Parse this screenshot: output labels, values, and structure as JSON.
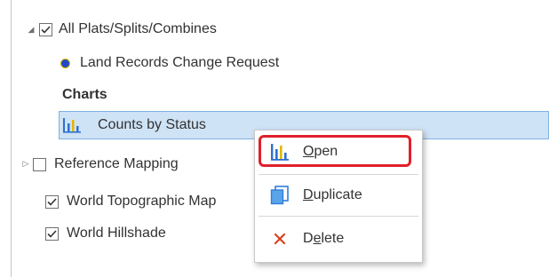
{
  "tree": {
    "layer_group": {
      "label": "All Plats/Splits/Combines",
      "checked": true,
      "expanded": true
    },
    "sublayer": {
      "label": "Land Records Change Request",
      "symbol_color": "#1f49c7"
    },
    "charts_heading": "Charts",
    "chart_item": {
      "label": "Counts by Status",
      "selected": true
    },
    "layers": [
      {
        "label": "Reference Mapping",
        "checked": false,
        "expanded": false
      },
      {
        "label": "World Topographic Map",
        "checked": true
      },
      {
        "label": "World Hillshade",
        "checked": true
      }
    ]
  },
  "context_menu": {
    "items": [
      {
        "label": "Open",
        "accel_index": 0,
        "icon": "bar-chart-icon",
        "highlighted": true
      },
      {
        "label": "Duplicate",
        "accel_index": 0,
        "icon": "duplicate-icon"
      },
      {
        "label": "Delete",
        "accel_index": 1,
        "icon": "delete-x-icon"
      }
    ]
  },
  "colors": {
    "selection_bg": "#cfe3f6",
    "selection_border": "#7fb2e3",
    "highlight_border": "#e0202a",
    "chart_icon_blue": "#2f6fcf",
    "chart_icon_yellow": "#e4b600",
    "delete_icon": "#d9411e"
  }
}
